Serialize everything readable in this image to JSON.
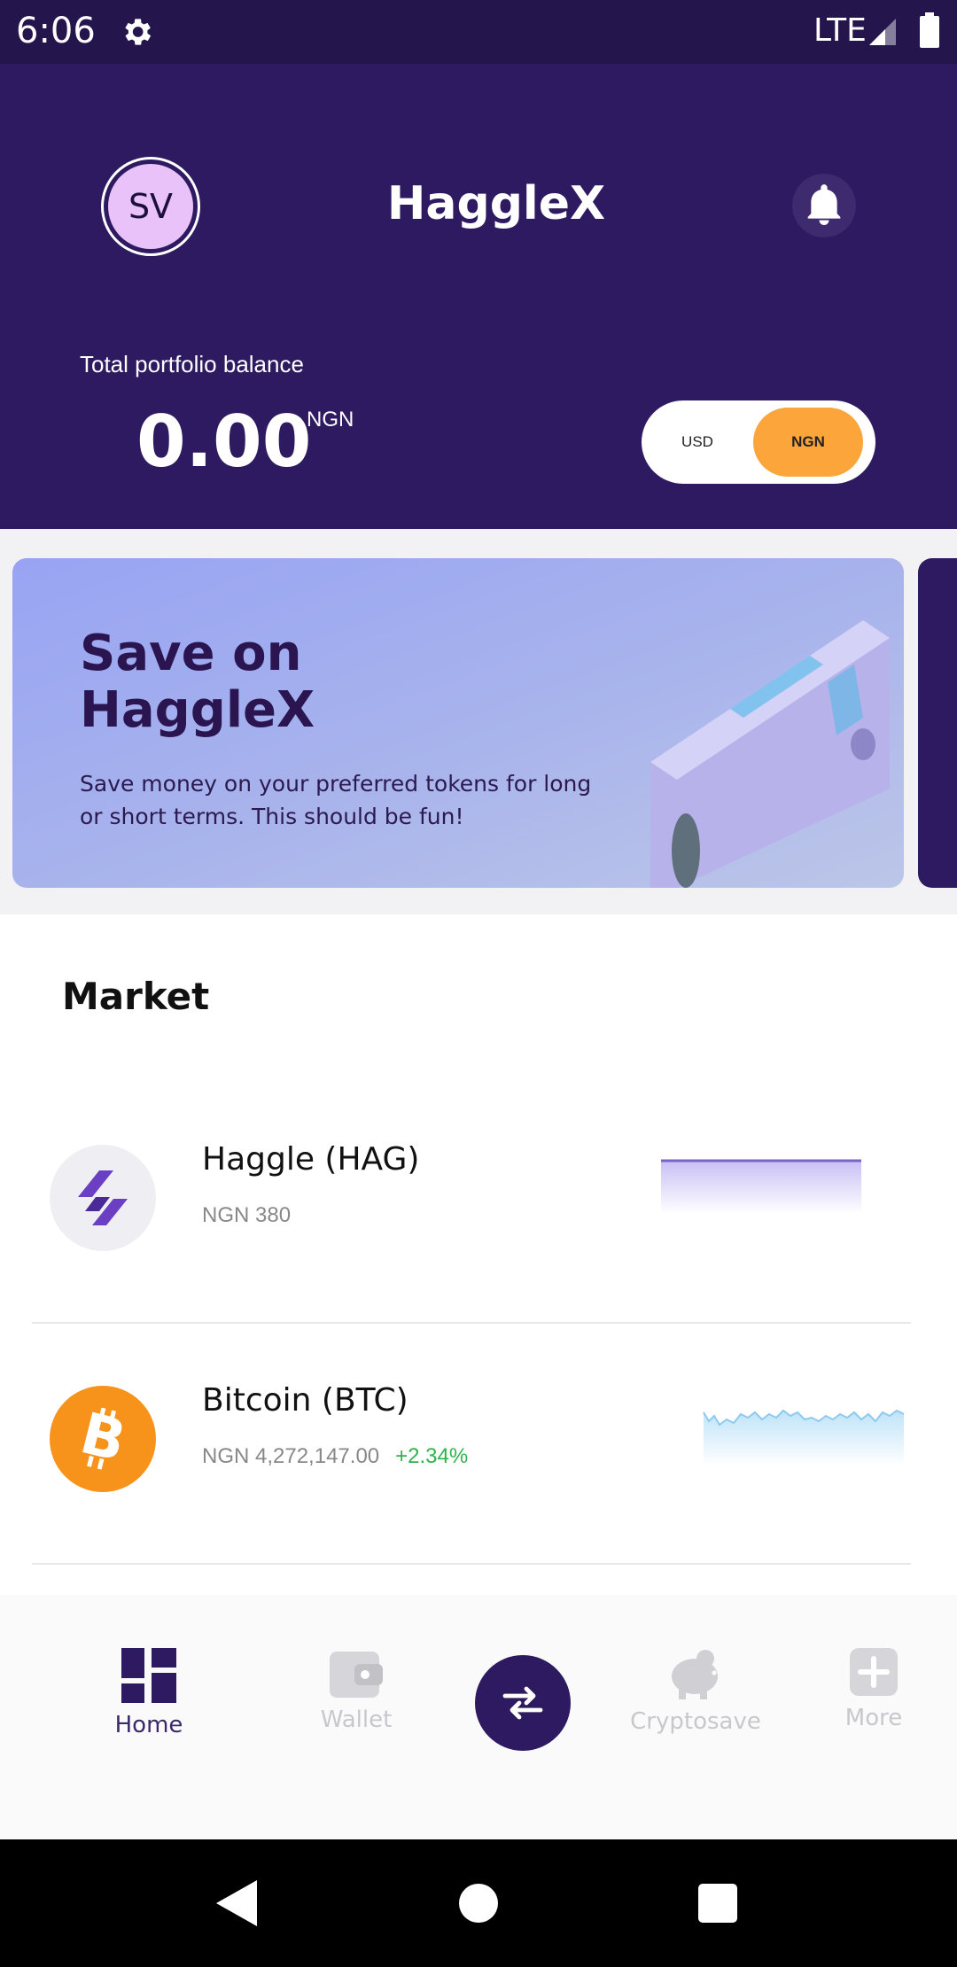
{
  "status_bar": {
    "time": "6:06",
    "network": "LTE"
  },
  "header": {
    "avatar_initials": "SV",
    "brand": "HaggleX",
    "balance_label": "Total portfolio balance",
    "balance_value": "0.00",
    "balance_currency": "NGN",
    "currency_toggle": {
      "options": [
        "USD",
        "NGN"
      ],
      "selected": "NGN"
    }
  },
  "banner": {
    "title": "Save on HaggleX",
    "description": "Save money on your preferred tokens for long or short terms. This should be fun!"
  },
  "market": {
    "title": "Market",
    "items": [
      {
        "name": "Haggle (HAG)",
        "price": "NGN 380",
        "change": "",
        "icon": "hag-logo-icon"
      },
      {
        "name": "Bitcoin (BTC)",
        "price": "NGN 4,272,147.00",
        "change": "+2.34%",
        "icon": "bitcoin-icon"
      }
    ]
  },
  "bottom_nav": {
    "items": [
      {
        "label": "Home",
        "icon": "home-grid-icon",
        "active": true
      },
      {
        "label": "Wallet",
        "icon": "wallet-icon",
        "active": false
      },
      {
        "label": "",
        "icon": "swap-icon",
        "active": false
      },
      {
        "label": "Cryptosave",
        "icon": "piggy-bank-icon",
        "active": false
      },
      {
        "label": "More",
        "icon": "plus-box-icon",
        "active": false
      }
    ]
  },
  "colors": {
    "primary": "#2e1a60",
    "status_bar": "#24154d",
    "accent": "#fba53a",
    "avatar_bg": "#e8c2f9",
    "positive": "#31b34b",
    "bitcoin": "#f7931a"
  }
}
